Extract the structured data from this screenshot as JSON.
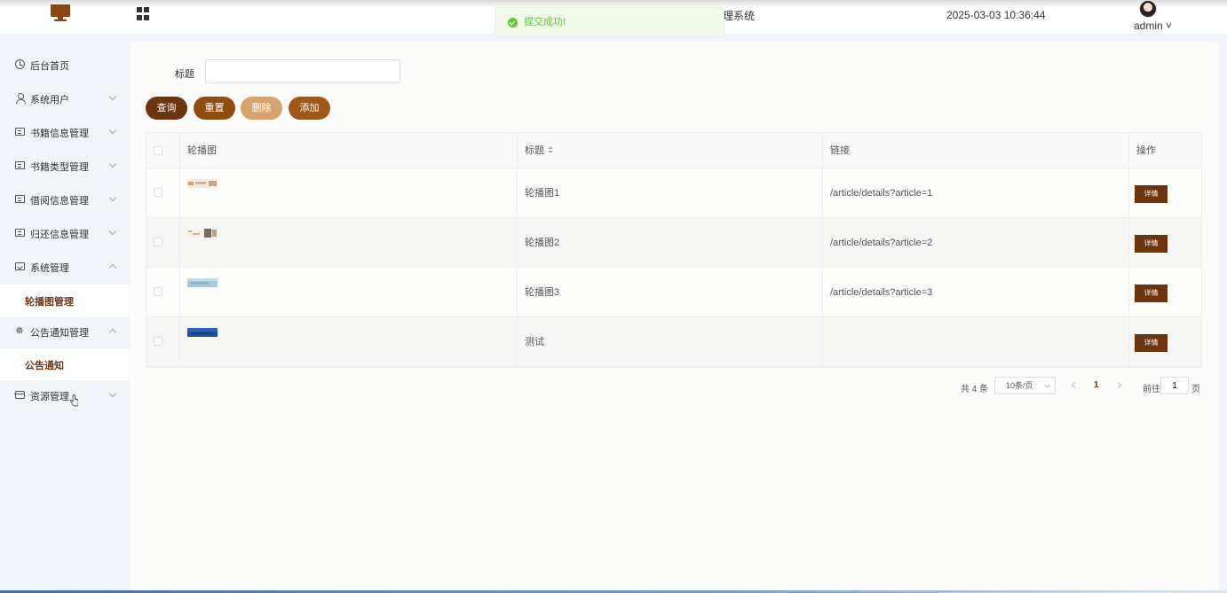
{
  "header": {
    "system_title_fragment": "理系统",
    "datetime": "2025-03-03 10:36:44",
    "username": "admin ˅"
  },
  "toast": {
    "message": "提交成功!",
    "type": "success"
  },
  "sidebar": {
    "items": [
      {
        "label": "后台首页",
        "icon": "clock-icon"
      },
      {
        "label": "系统用户",
        "icon": "user-icon"
      },
      {
        "label": "书籍信息管理",
        "icon": "card-icon"
      },
      {
        "label": "书籍类型管理",
        "icon": "card-icon"
      },
      {
        "label": "借阅信息管理",
        "icon": "card-icon"
      },
      {
        "label": "归还信息管理",
        "icon": "card-icon"
      },
      {
        "label": "系统管理",
        "icon": "folder-check-icon"
      },
      {
        "label": "轮播图管理",
        "icon": ""
      },
      {
        "label": "公告通知管理",
        "icon": "spark-icon"
      },
      {
        "label": "公告通知",
        "icon": ""
      },
      {
        "label": "资源管理",
        "icon": "box-icon"
      }
    ]
  },
  "search": {
    "label": "标题",
    "value": "",
    "placeholder": ""
  },
  "buttons": {
    "query": "查询",
    "reset": "重置",
    "delete": "删除",
    "add": "添加"
  },
  "table": {
    "headers": [
      "轮播图",
      "标题",
      "链接",
      "操作"
    ],
    "rows": [
      {
        "title": "轮播图1",
        "link": "/article/details?article=1",
        "action": "详情"
      },
      {
        "title": "轮播图2",
        "link": "/article/details?article=2",
        "action": "详情"
      },
      {
        "title": "轮播图3",
        "link": "/article/details?article=3",
        "action": "详情"
      },
      {
        "title": "测试",
        "link": "",
        "action": "详情"
      }
    ]
  },
  "pagination": {
    "total_text": "共 4 条",
    "page_size": "10条/页",
    "current_page": "1",
    "goto_label": "前往",
    "goto_value": "1",
    "page_suffix": "页"
  },
  "colors": {
    "accent": "#6b3510",
    "accent_light": "#d9a36d",
    "success": "#67c23a"
  }
}
